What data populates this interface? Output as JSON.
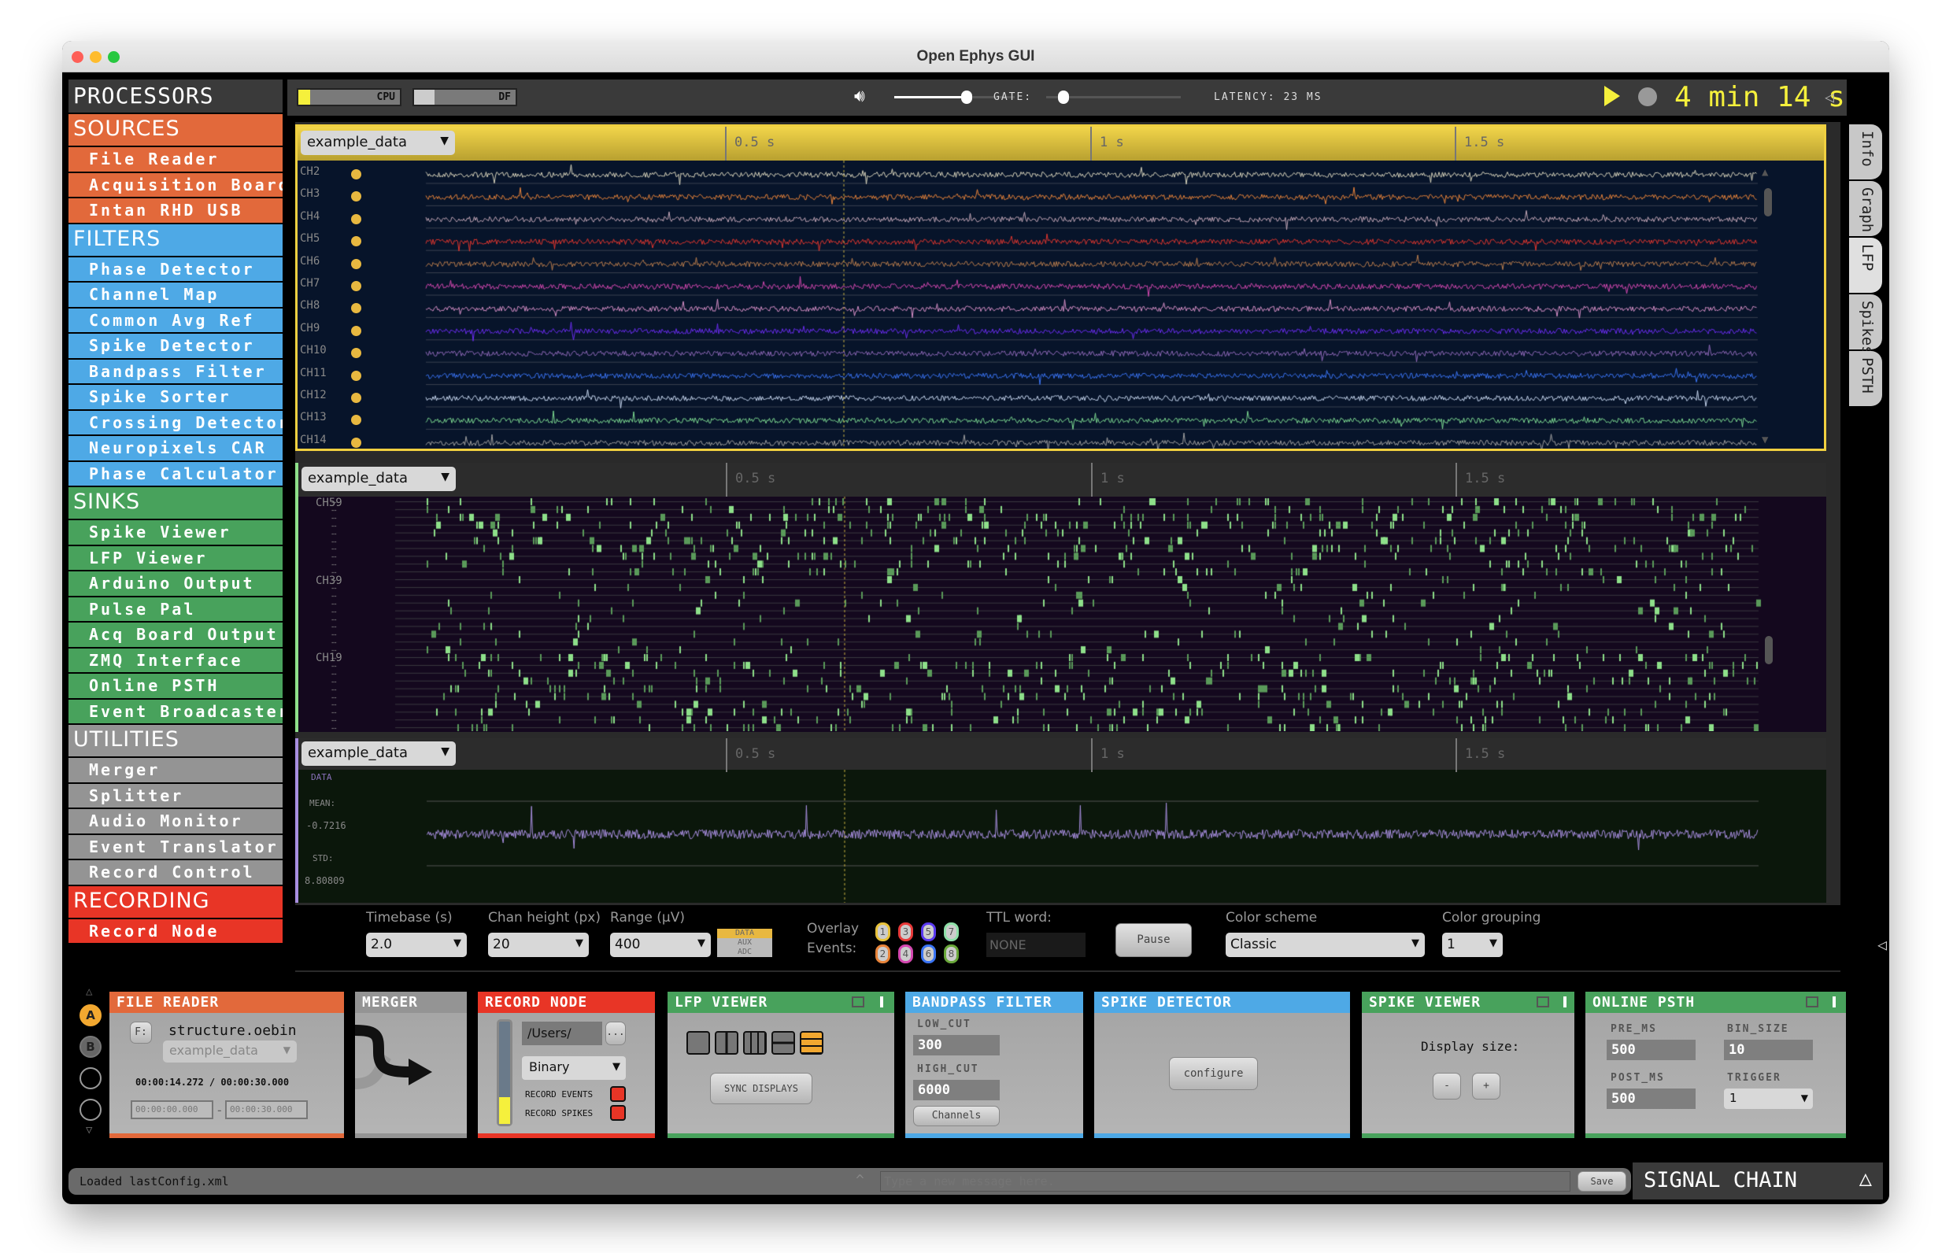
{
  "window": {
    "title": "Open Ephys GUI"
  },
  "sidebar": {
    "title": "PROCESSORS",
    "categories": [
      {
        "name": "SOURCES",
        "color": "#e2693b",
        "items": [
          "File Reader",
          "Acquisition Board",
          "Intan RHD USB"
        ]
      },
      {
        "name": "FILTERS",
        "color": "#4ea9e6",
        "items": [
          "Phase Detector",
          "Channel Map",
          "Common Avg Ref",
          "Spike Detector",
          "Bandpass Filter",
          "Spike Sorter",
          "Crossing Detector",
          "Neuropixels CAR",
          "Phase Calculator"
        ]
      },
      {
        "name": "SINKS",
        "color": "#48a25c",
        "items": [
          "Spike Viewer",
          "LFP Viewer",
          "Arduino Output",
          "Pulse Pal",
          "Acq Board Output",
          "ZMQ Interface",
          "Online PSTH",
          "Event Broadcaster"
        ]
      },
      {
        "name": "UTILITIES",
        "color": "#949494",
        "items": [
          "Merger",
          "Splitter",
          "Audio Monitor",
          "Event Translator",
          "Record Control"
        ]
      },
      {
        "name": "RECORDING",
        "color": "#e83526",
        "items": [
          "Record Node"
        ]
      }
    ]
  },
  "toolbar": {
    "cpu_label": "CPU",
    "df_label": "DF",
    "cpu_level": 0.12,
    "df_level": 0.2,
    "volume": 0.6,
    "gate_label": "GATE:",
    "gate": 0.03,
    "latency": "LATENCY: 23 MS",
    "clock": "4 min 14 s",
    "accent": "#f5f03c"
  },
  "displays": [
    {
      "source": "example_data",
      "ticks": [
        "0.5 s",
        "1 s",
        "1.5 s"
      ]
    },
    {
      "source": "example_data",
      "ticks": [
        "0.5 s",
        "1 s",
        "1.5 s"
      ]
    },
    {
      "source": "example_data",
      "ticks": [
        "0.5 s",
        "1 s",
        "1.5 s"
      ]
    }
  ],
  "lfp": {
    "channels": [
      "CH2",
      "CH3",
      "CH4",
      "CH5",
      "CH6",
      "CH7",
      "CH8",
      "CH9",
      "CH10",
      "CH11",
      "CH12",
      "CH13",
      "CH14"
    ],
    "colors": [
      "#d8d4bc",
      "#e8843a",
      "#c4a8b8",
      "#e0362e",
      "#b87c4c",
      "#d448b0",
      "#d890c8",
      "#6a2cf0",
      "#8e68b8",
      "#3a74f4",
      "#c8d8f0",
      "#7cd890",
      "#a0a0a0"
    ]
  },
  "raster": {
    "labels": [
      "CH59",
      "CH39",
      "CH19"
    ],
    "color": "#8ee08a"
  },
  "single": {
    "label": "DATA",
    "mean_label": "MEAN:",
    "mean": "-0.7216",
    "std_label": "STD:",
    "std": "8.80809",
    "color": "#a88ee0"
  },
  "controls": {
    "timebase_label": "Timebase (s)",
    "timebase": "2.0",
    "chan_height_label": "Chan height (px)",
    "chan_height": "20",
    "range_label": "Range (µV)",
    "range": "400",
    "range_types": [
      "DATA",
      "AUX",
      "ADC"
    ],
    "overlay_label": "Overlay",
    "events_label": "Events:",
    "events": [
      {
        "n": "1",
        "c": "#e8c23a"
      },
      {
        "n": "3",
        "c": "#e83a3a"
      },
      {
        "n": "5",
        "c": "#5a3af0"
      },
      {
        "n": "7",
        "c": "#8ee0a8"
      },
      {
        "n": "2",
        "c": "#e8843a"
      },
      {
        "n": "4",
        "c": "#d448b0"
      },
      {
        "n": "6",
        "c": "#3a74f4"
      },
      {
        "n": "8",
        "c": "#6aa83a"
      }
    ],
    "ttl_label": "TTL word:",
    "ttl": "NONE",
    "pause": "Pause",
    "color_scheme_label": "Color scheme",
    "color_scheme": "Classic",
    "color_grouping_label": "Color grouping",
    "color_grouping": "1"
  },
  "tabs": [
    "Info",
    "Graph",
    "LFP",
    "Spikes",
    "PSTH"
  ],
  "chain": {
    "streams": [
      "A",
      "B"
    ],
    "file_reader": {
      "title": "FILE READER",
      "drive": "F:",
      "file": "structure.oebin",
      "stream": "example_data",
      "position": "00:00:14.272 / 00:00:30.000",
      "start": "00:00:00.000",
      "end": "00:00:30.000"
    },
    "merger": {
      "title": "MERGER"
    },
    "record_node": {
      "title": "RECORD NODE",
      "path": "/Users/",
      "browse": "...",
      "format": "Binary",
      "rec_events": "RECORD EVENTS",
      "rec_spikes": "RECORD SPIKES"
    },
    "lfp_viewer": {
      "title": "LFP VIEWER",
      "sync": "SYNC DISPLAYS"
    },
    "bandpass": {
      "title": "BANDPASS FILTER",
      "low_label": "LOW_CUT",
      "low": "300",
      "high_label": "HIGH_CUT",
      "high": "6000",
      "channels": "Channels"
    },
    "spike_detector": {
      "title": "SPIKE DETECTOR",
      "configure": "configure"
    },
    "spike_viewer": {
      "title": "SPIKE VIEWER",
      "display_size": "Display size:",
      "minus": "-",
      "plus": "+"
    },
    "psth": {
      "title": "ONLINE PSTH",
      "pre_label": "PRE_MS",
      "pre": "500",
      "bin_label": "BIN_SIZE",
      "bin": "10",
      "post_label": "POST_MS",
      "post": "500",
      "trigger_label": "TRIGGER",
      "trigger": "1"
    }
  },
  "status": {
    "message": "Loaded lastConfig.xml",
    "placeholder": "Type a new message here.",
    "save": "Save",
    "signal_chain": "SIGNAL CHAIN"
  }
}
